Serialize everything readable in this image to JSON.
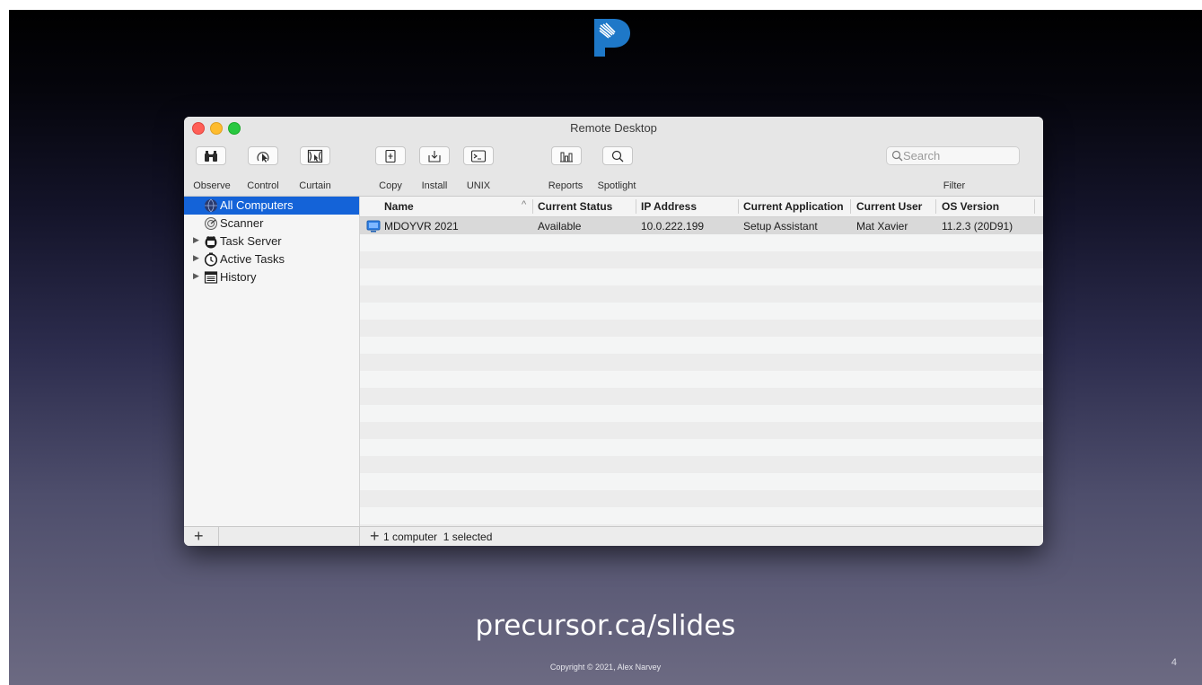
{
  "window": {
    "title": "Remote Desktop"
  },
  "toolbar": {
    "buttons": [
      {
        "label": "Observe",
        "icon": "binoculars-icon"
      },
      {
        "label": "Control",
        "icon": "control-cursor-icon"
      },
      {
        "label": "Curtain",
        "icon": "curtain-icon"
      },
      {
        "label": "Copy",
        "icon": "copy-document-icon"
      },
      {
        "label": "Install",
        "icon": "install-package-icon"
      },
      {
        "label": "UNIX",
        "icon": "terminal-icon"
      },
      {
        "label": "Reports",
        "icon": "reports-chart-icon"
      },
      {
        "label": "Spotlight",
        "icon": "magnifier-icon"
      }
    ],
    "search_placeholder": "Search",
    "filter_label": "Filter"
  },
  "sidebar": {
    "items": [
      {
        "label": "All Computers",
        "selected": true,
        "icon": "globe-icon"
      },
      {
        "label": "Scanner",
        "icon": "scanner-icon"
      },
      {
        "label": "Task Server",
        "icon": "task-server-icon",
        "expandable": true
      },
      {
        "label": "Active Tasks",
        "icon": "active-tasks-icon",
        "expandable": true
      },
      {
        "label": "History",
        "icon": "history-icon",
        "expandable": true
      }
    ]
  },
  "table": {
    "columns": [
      "Name",
      "Current Status",
      "IP Address",
      "Current Application",
      "Current User",
      "OS Version"
    ],
    "rows": [
      {
        "name": "MDOYVR 2021",
        "status": "Available",
        "ip": "10.0.222.199",
        "application": "Setup Assistant",
        "user": "Mat Xavier",
        "os": "11.2.3 (20D91)",
        "selected": true
      }
    ]
  },
  "footer": {
    "add_symbol": "+",
    "count_text": "1 computer",
    "selected_text": "1 selected"
  },
  "slide": {
    "url": "precursor.ca/slides",
    "copyright": "Copyright © 2021, Alex Narvey",
    "page_number": "4"
  },
  "colors": {
    "selection": "#1463d8",
    "logo_blue": "#1e78c8"
  }
}
